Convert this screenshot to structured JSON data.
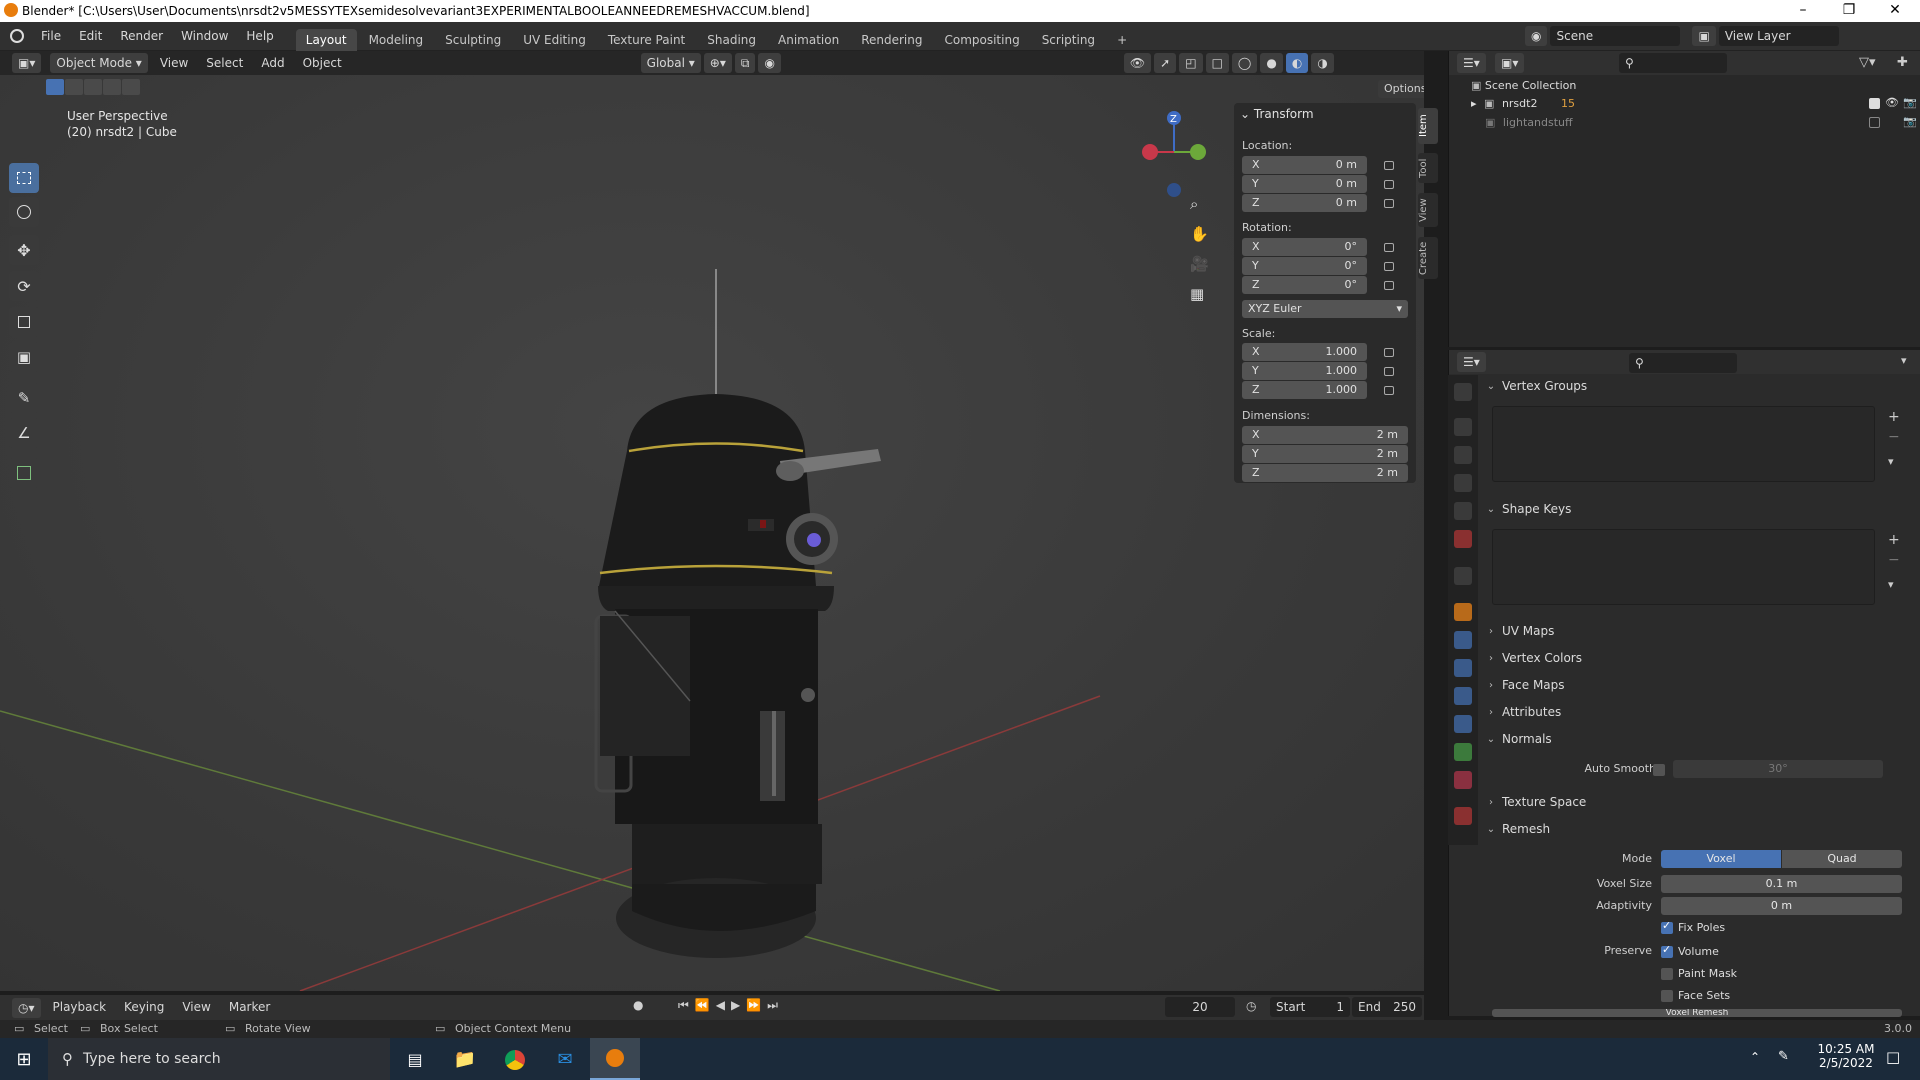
{
  "window": {
    "title": "Blender* [C:\\Users\\User\\Documents\\nrsdt2v5MESSYTEXsemidesolvevariant3EXPERIMENTALBOOLEANNEEDREMESHVACCUM.blend]"
  },
  "menu": [
    "File",
    "Edit",
    "Render",
    "Window",
    "Help"
  ],
  "workspaces": [
    "Layout",
    "Modeling",
    "Sculpting",
    "UV Editing",
    "Texture Paint",
    "Shading",
    "Animation",
    "Rendering",
    "Compositing",
    "Scripting"
  ],
  "workspace_add": "+",
  "scene": {
    "name": "Scene",
    "view_layer": "View Layer"
  },
  "viewport_header": {
    "mode": "Object Mode",
    "menus": [
      "View",
      "Select",
      "Add",
      "Object"
    ],
    "orientation": "Global",
    "options": "Options"
  },
  "viewport": {
    "perspective": "User Perspective",
    "object_info": "(20) nrsdt2 | Cube"
  },
  "gizmo": {
    "z": "Z"
  },
  "npanel": {
    "tabs": [
      "Item",
      "Tool",
      "View",
      "Create"
    ],
    "title": "Transform",
    "location_label": "Location:",
    "location": [
      {
        "axis": "X",
        "value": "0 m"
      },
      {
        "axis": "Y",
        "value": "0 m"
      },
      {
        "axis": "Z",
        "value": "0 m"
      }
    ],
    "rotation_label": "Rotation:",
    "rotation": [
      {
        "axis": "X",
        "value": "0°"
      },
      {
        "axis": "Y",
        "value": "0°"
      },
      {
        "axis": "Z",
        "value": "0°"
      }
    ],
    "rotation_mode": "XYZ Euler",
    "scale_label": "Scale:",
    "scale": [
      {
        "axis": "X",
        "value": "1.000"
      },
      {
        "axis": "Y",
        "value": "1.000"
      },
      {
        "axis": "Z",
        "value": "1.000"
      }
    ],
    "dimensions_label": "Dimensions:",
    "dimensions": [
      {
        "axis": "X",
        "value": "2 m"
      },
      {
        "axis": "Y",
        "value": "2 m"
      },
      {
        "axis": "Z",
        "value": "2 m"
      }
    ]
  },
  "outliner": {
    "collection": "Scene Collection",
    "items": [
      {
        "name": "nrsdt2",
        "badge": "15"
      },
      {
        "name": "lightandstuff"
      }
    ]
  },
  "properties": {
    "vertex_groups": "Vertex Groups",
    "shape_keys": "Shape Keys",
    "uv_maps": "UV Maps",
    "vertex_colors": "Vertex Colors",
    "face_maps": "Face Maps",
    "attributes": "Attributes",
    "normals": "Normals",
    "auto_smooth_label": "Auto Smooth",
    "auto_smooth_angle": "30°",
    "texture_space": "Texture Space",
    "remesh": "Remesh",
    "mode_label": "Mode",
    "mode_voxel": "Voxel",
    "mode_quad": "Quad",
    "voxel_size_label": "Voxel Size",
    "voxel_size": "0.1 m",
    "adaptivity_label": "Adaptivity",
    "adaptivity": "0 m",
    "fix_poles": "Fix Poles",
    "preserve_label": "Preserve",
    "volume": "Volume",
    "paint_mask": "Paint Mask",
    "face_sets": "Face Sets",
    "voxel_remesh": "Voxel Remesh"
  },
  "timeline": {
    "menus": [
      "Playback",
      "Keying",
      "View",
      "Marker"
    ],
    "current_frame": "20",
    "start_label": "Start",
    "start": "1",
    "end_label": "End",
    "end": "250"
  },
  "statusbar": {
    "select": "Select",
    "box_select": "Box Select",
    "rotate_view": "Rotate View",
    "context_menu": "Object Context Menu",
    "version": "3.0.0"
  },
  "taskbar": {
    "search_placeholder": "Type here to search",
    "time": "10:25 AM",
    "date": "2/5/2022"
  }
}
